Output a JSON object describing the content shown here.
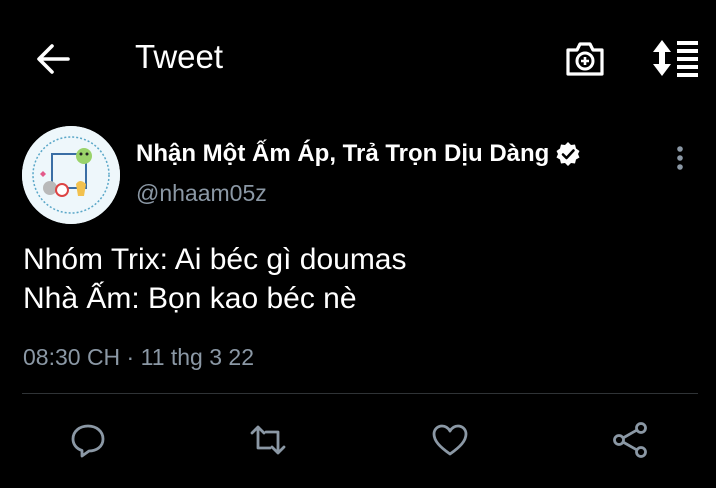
{
  "header": {
    "title": "Tweet",
    "back_icon": "arrow-left-icon",
    "camera_icon": "camera-plus-icon",
    "sort_icon": "sort-list-icon"
  },
  "author": {
    "display_name": "Nhận Một Ấm Áp, Trả Trọn Dịu Dàng",
    "handle": "@nhaam05z",
    "verified": true,
    "avatar_icon": "avatar-image"
  },
  "tweet": {
    "lines": [
      "Nhóm Trix: Ai béc gì doumas",
      "Nhà Ấm: Bọn kao béc nè"
    ],
    "timestamp": "08:30 CH · 11 thg 3 22"
  },
  "actions": {
    "reply_icon": "reply-bubble-icon",
    "retweet_icon": "retweet-icon",
    "like_icon": "heart-icon",
    "share_icon": "share-icon"
  },
  "colors": {
    "background": "#000000",
    "text_primary": "#ffffff",
    "text_secondary": "#8b98a5",
    "icon": "#8b98a5",
    "divider": "#2f3336"
  }
}
